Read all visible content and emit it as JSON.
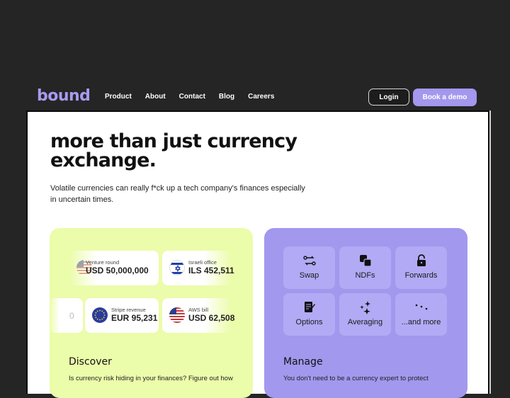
{
  "nav": {
    "logo": "bound",
    "links": [
      "Product",
      "About",
      "Contact",
      "Blog",
      "Careers"
    ],
    "login_label": "Login",
    "demo_label": "Book a demo"
  },
  "hero": {
    "title": "more than just currency exchange.",
    "subtitle": "Volatile currencies can really f*ck up a tech company's finances especially in uncertain times."
  },
  "discover": {
    "title": "Discover",
    "description": "Is currency risk hiding in your finances? Figure out how",
    "tiles": [
      {
        "label": "Venture round",
        "value": "USD 50,000,000",
        "flag": "us-flag"
      },
      {
        "label": "Israeli office",
        "value": "ILS 452,511",
        "flag": "israel-flag"
      },
      {
        "label": "",
        "value": "0",
        "flag": ""
      },
      {
        "label": "Stripe revenue",
        "value": "EUR 95,231",
        "flag": "eu-flag"
      },
      {
        "label": "AWS bill",
        "value": "USD 62,508",
        "flag": "us-flag"
      }
    ]
  },
  "manage": {
    "title": "Manage",
    "description": "You don't need to be a currency expert to protect",
    "products": [
      {
        "label": "Swap",
        "icon": "swap-icon"
      },
      {
        "label": "NDFs",
        "icon": "overlap-squares-icon"
      },
      {
        "label": "Forwards",
        "icon": "lock-icon"
      },
      {
        "label": "Options",
        "icon": "document-pen-icon"
      },
      {
        "label": "Averaging",
        "icon": "sparkles-icon"
      },
      {
        "label": "...and more",
        "icon": "dots-icon"
      }
    ]
  },
  "colors": {
    "brand": "#a89af0",
    "discover_bg": "#ebfcaa",
    "manage_bg": "#a298ee",
    "tile_bg": "#b2aaf4"
  }
}
